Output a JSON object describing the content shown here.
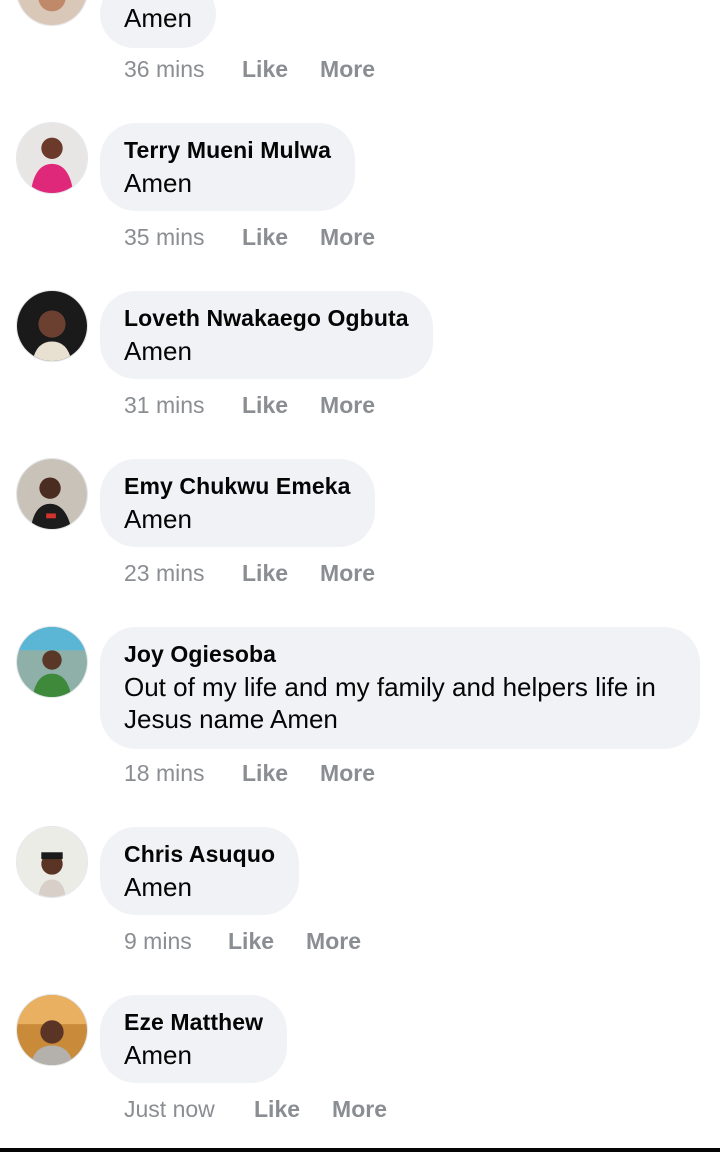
{
  "comments": [
    {
      "name": "",
      "text": "Amen",
      "time": "36 mins",
      "like": "Like",
      "more": "More"
    },
    {
      "name": "Terry Mueni Mulwa",
      "text": "Amen",
      "time": "35 mins",
      "like": "Like",
      "more": "More"
    },
    {
      "name": "Loveth Nwakaego Ogbuta",
      "text": "Amen",
      "time": "31 mins",
      "like": "Like",
      "more": "More"
    },
    {
      "name": "Emy Chukwu Emeka",
      "text": "Amen",
      "time": "23 mins",
      "like": "Like",
      "more": "More"
    },
    {
      "name": "Joy Ogiesoba",
      "text": "Out of my life and my family and helpers life in Jesus name Amen",
      "time": "18 mins",
      "like": "Like",
      "more": "More"
    },
    {
      "name": "Chris Asuquo",
      "text": "Amen",
      "time": "9 mins",
      "like": "Like",
      "more": "More"
    },
    {
      "name": "Eze Matthew",
      "text": "Amen",
      "time": "Just now",
      "like": "Like",
      "more": "More"
    }
  ]
}
